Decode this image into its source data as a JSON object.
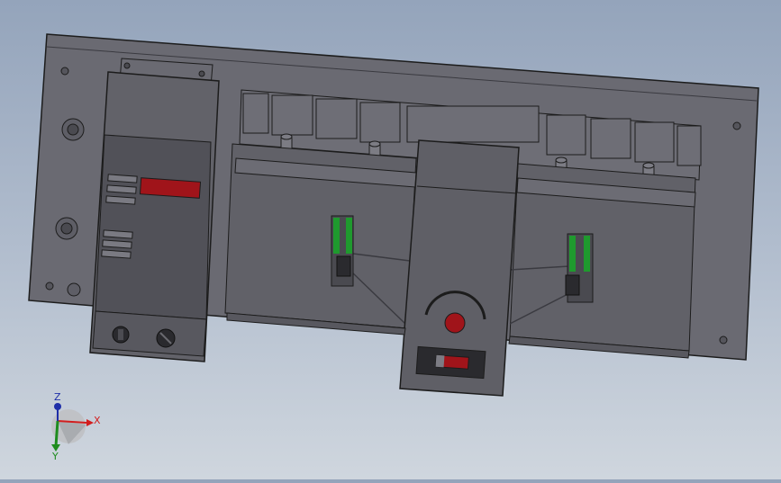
{
  "axes": {
    "x_label": "X",
    "y_label": "Y",
    "z_label": "Z"
  },
  "colors": {
    "background_top": "#94a4bb",
    "background_bottom": "#cfd6de",
    "panel": "#616168",
    "panel_dark": "#55555c",
    "indicator_red": "#a0141a",
    "slider_green": "#1f9a2e",
    "axis_x": "#d21e1e",
    "axis_y": "#1e8c1e",
    "axis_z": "#1e2ea8"
  },
  "icons": {
    "left_knob": "slotted-knob-icon",
    "right_knob": "rotary-knob-icon",
    "center_indicator": "red-indicator-icon"
  }
}
